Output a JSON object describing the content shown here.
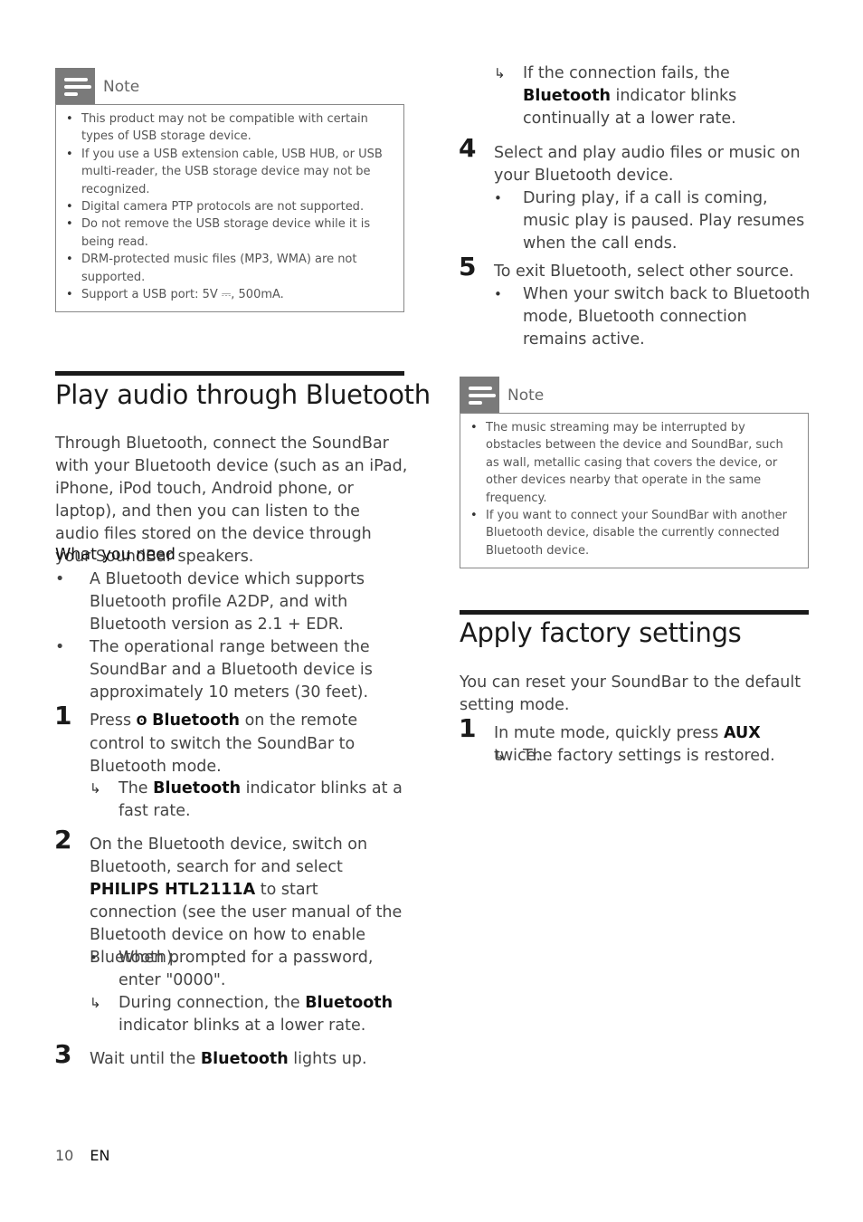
{
  "page": {
    "page_number": "10",
    "language": "EN"
  },
  "note1": {
    "title": "Note",
    "items": [
      "This product may not be compatible with certain types of USB storage device.",
      "If you use a USB extension cable, USB HUB, or USB multi-reader, the USB storage device may not be recognized.",
      "Digital camera PTP protocols are not supported.",
      "Do not remove the USB storage device while it is being read.",
      "DRM-protected music files (MP3, WMA) are not supported.",
      "Support a USB port: 5V ⎓, 500mA."
    ]
  },
  "bluetooth": {
    "title": "Play audio through Bluetooth",
    "intro": "Through Bluetooth, connect the SoundBar with your Bluetooth device (such as an iPad, iPhone, iPod touch, Android phone, or laptop), and then you can listen to the audio files stored on the device through your SoundBar speakers.",
    "what_you_need": "What you need",
    "needs": [
      "A Bluetooth device which supports Bluetooth profile A2DP, and with Bluetooth version as 2.1 + EDR.",
      "The operational range between the SoundBar and a Bluetooth device is approximately 10 meters (30 feet)."
    ],
    "step1": {
      "num": "1",
      "pre": "Press ",
      "icon": "bluetooth-icon",
      "bold": "Bluetooth",
      "post": " on the remote control to switch the SoundBar to Bluetooth mode.",
      "result_pre": "The ",
      "result_bold": "Bluetooth",
      "result_post": " indicator blinks at a fast rate."
    },
    "step2": {
      "num": "2",
      "pre": "On the Bluetooth device, switch on Bluetooth, search for and select ",
      "bold": "PHILIPS HTL2111A",
      "post": " to start connection (see the user manual of the Bluetooth device on how to enable Bluetooth).",
      "bullet": "When prompted for a password, enter \"0000\".",
      "result_pre": "During connection, the ",
      "result_bold": "Bluetooth",
      "result_post": " indicator blinks at a lower rate."
    },
    "step3": {
      "num": "3",
      "pre": "Wait until the ",
      "bold": "Bluetooth",
      "post": " lights up.",
      "result_pre": "If the connection fails, the ",
      "result_bold": "Bluetooth",
      "result_post": " indicator blinks continually at a lower rate."
    },
    "step4": {
      "num": "4",
      "text": "Select and play audio files or music on your Bluetooth device.",
      "bullet": "During play, if a call is coming, music play is paused. Play resumes when the call ends."
    },
    "step5": {
      "num": "5",
      "text": "To exit Bluetooth, select other source.",
      "bullet": "When your switch back to Bluetooth mode, Bluetooth connection remains active."
    }
  },
  "note2": {
    "title": "Note",
    "items": [
      "The music streaming may be interrupted by obstacles between the device and SoundBar, such as wall, metallic casing that covers the device, or other devices nearby that operate in the same frequency.",
      "If you want to connect your SoundBar with another Bluetooth device, disable the currently connected Bluetooth device."
    ]
  },
  "factory": {
    "title": "Apply factory settings",
    "intro": "You can reset your SoundBar to the default setting mode.",
    "step1": {
      "num": "1",
      "pre": "In mute mode, quickly press ",
      "bold": "AUX",
      "post": " twice.",
      "result": "The factory settings is restored."
    }
  },
  "symbols": {
    "bullet": "•",
    "arrow": "↳"
  }
}
